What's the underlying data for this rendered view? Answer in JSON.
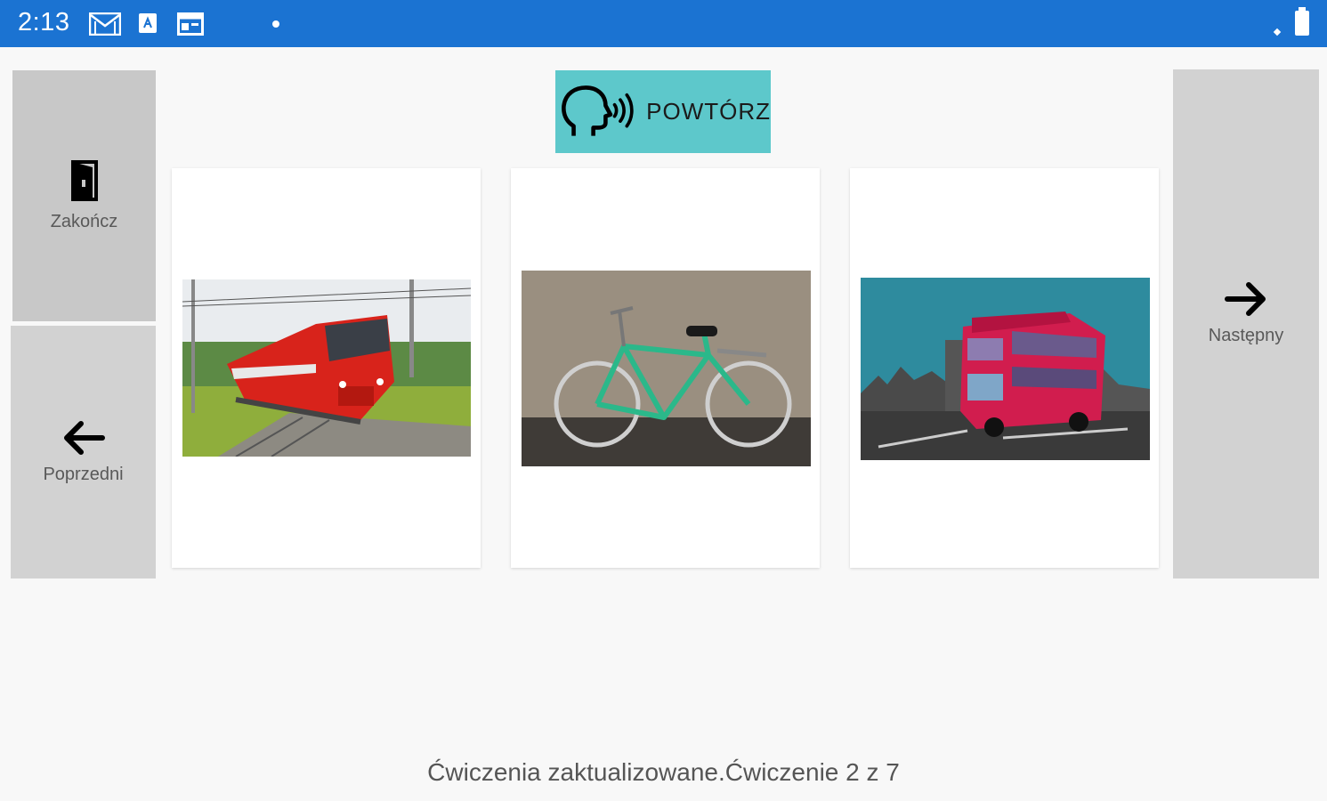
{
  "status_bar": {
    "time": "2:13",
    "icons": [
      "gmail-icon",
      "app-store-icon",
      "calendar-icon",
      "notification-dot",
      "signal-icon",
      "battery-icon"
    ]
  },
  "buttons": {
    "exit": {
      "label": "Zakończ",
      "icon": "door-exit-icon"
    },
    "previous": {
      "label": "Poprzedni",
      "icon": "arrow-left-icon"
    },
    "next": {
      "label": "Następny",
      "icon": "arrow-right-icon"
    },
    "repeat": {
      "label": "POWTÓRZ",
      "icon": "speaking-head-icon"
    }
  },
  "cards": [
    {
      "name": "train",
      "image": "red-train-photo"
    },
    {
      "name": "bicycle",
      "image": "green-bicycle-photo"
    },
    {
      "name": "bus",
      "image": "red-double-decker-bus-photo"
    }
  ],
  "colors": {
    "status_bar": "#1b73d2",
    "repeat_button": "#5dc8cb",
    "side_button": "#d2d2d2",
    "background": "#f8f8f8"
  },
  "footer": {
    "status": "Ćwiczenia zaktualizowane.Ćwiczenie 2 z 7"
  }
}
